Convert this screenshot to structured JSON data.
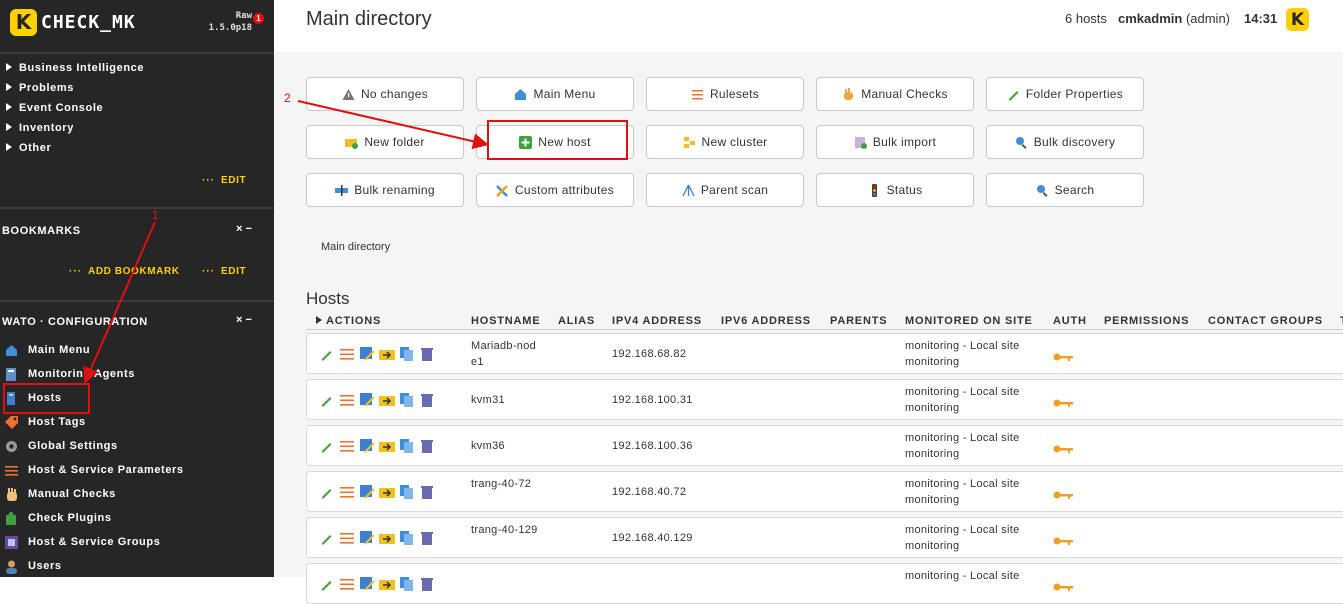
{
  "sidebar": {
    "logo_letter": "K",
    "logo_text": "CHECK_MK",
    "edition": "Raw",
    "version": "1.5.0p18",
    "badge_count": "1",
    "tree": [
      "Business Intelligence",
      "Problems",
      "Event Console",
      "Inventory",
      "Other"
    ],
    "edit_label": "EDIT",
    "dots": "···",
    "bookmarks_title": "BOOKMARKS",
    "add_bookmark_label": "ADD BOOKMARK",
    "wato_title": "WATO · CONFIGURATION",
    "close_glyph": "×",
    "minimize_glyph": "−",
    "nav": [
      {
        "label": "Main Menu",
        "icon": "house-icon"
      },
      {
        "label": "Monitoring Agents",
        "icon": "agent-icon"
      },
      {
        "label": "Hosts",
        "icon": "server-icon"
      },
      {
        "label": "Host Tags",
        "icon": "tag-icon"
      },
      {
        "label": "Global Settings",
        "icon": "gear-icon"
      },
      {
        "label": "Host & Service Parameters",
        "icon": "sliders-icon"
      },
      {
        "label": "Manual Checks",
        "icon": "hand-icon"
      },
      {
        "label": "Check Plugins",
        "icon": "puzzle-icon"
      },
      {
        "label": "Host & Service Groups",
        "icon": "groups-icon"
      },
      {
        "label": "Users",
        "icon": "users-icon"
      }
    ]
  },
  "header": {
    "title": "Main directory",
    "host_count": "6 hosts",
    "username": "cmkadmin",
    "role": "(admin)",
    "time": "14:31",
    "logo_letter": "K"
  },
  "buttons": [
    {
      "label": "No changes",
      "icon": "warning-icon"
    },
    {
      "label": "Main Menu",
      "icon": "house-icon"
    },
    {
      "label": "Rulesets",
      "icon": "sliders-icon"
    },
    {
      "label": "Manual Checks",
      "icon": "hand-icon"
    },
    {
      "label": "Folder Properties",
      "icon": "pencil-icon"
    },
    {
      "label": "New folder",
      "icon": "folder-plus-icon"
    },
    {
      "label": "New host",
      "icon": "plus-icon"
    },
    {
      "label": "New cluster",
      "icon": "cluster-icon"
    },
    {
      "label": "Bulk import",
      "icon": "import-icon"
    },
    {
      "label": "Bulk discovery",
      "icon": "magnifier-icon"
    },
    {
      "label": "Bulk renaming",
      "icon": "rename-icon"
    },
    {
      "label": "Custom attributes",
      "icon": "tools-icon"
    },
    {
      "label": "Parent scan",
      "icon": "tree-icon"
    },
    {
      "label": "Status",
      "icon": "traffic-light-icon"
    },
    {
      "label": "Search",
      "icon": "search-icon"
    }
  ],
  "breadcrumb": "Main directory",
  "hosts_title": "Hosts",
  "table": {
    "columns": [
      "ACTIONS",
      "HOSTNAME",
      "ALIAS",
      "IPV4 ADDRESS",
      "IPV6 ADDRESS",
      "PARENTS",
      "MONITORED ON SITE",
      "AUTH",
      "PERMISSIONS",
      "CONTACT GROUPS",
      "T"
    ],
    "rows": [
      {
        "hostname": "Mariadb-node1",
        "ipv4": "192.168.68.82",
        "site": "monitoring - Local site monitoring"
      },
      {
        "hostname": "kvm31",
        "ipv4": "192.168.100.31",
        "site": "monitoring - Local site monitoring"
      },
      {
        "hostname": "kvm36",
        "ipv4": "192.168.100.36",
        "site": "monitoring - Local site monitoring"
      },
      {
        "hostname": "trang-40-72",
        "ipv4": "192.168.40.72",
        "site": "monitoring - Local site monitoring"
      },
      {
        "hostname": "trang-40-129",
        "ipv4": "192.168.40.129",
        "site": "monitoring - Local site monitoring"
      },
      {
        "hostname": "",
        "ipv4": "",
        "site": "monitoring - Local site"
      }
    ]
  },
  "annotations": {
    "step1": "1",
    "step2": "2"
  },
  "colors": {
    "sidebar_bg": "#262626",
    "accent_yellow": "#ffd000",
    "highlight_red": "#e01010",
    "content_bg": "#f5f5f5"
  }
}
